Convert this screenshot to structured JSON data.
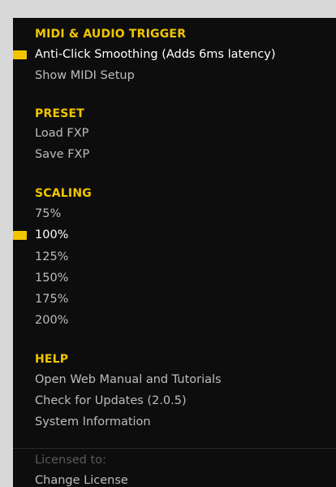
{
  "sections": {
    "midi_audio": {
      "title": "MIDI & AUDIO TRIGGER",
      "items": [
        {
          "label": "Anti-Click Smoothing (Adds 6ms latency)",
          "checked": true
        },
        {
          "label": "Show MIDI Setup",
          "checked": false
        }
      ]
    },
    "preset": {
      "title": "PRESET",
      "items": [
        {
          "label": "Load FXP",
          "checked": false
        },
        {
          "label": "Save FXP",
          "checked": false
        }
      ]
    },
    "scaling": {
      "title": "SCALING",
      "items": [
        {
          "label": "75%",
          "checked": false
        },
        {
          "label": "100%",
          "checked": true
        },
        {
          "label": "125%",
          "checked": false
        },
        {
          "label": "150%",
          "checked": false
        },
        {
          "label": "175%",
          "checked": false
        },
        {
          "label": "200%",
          "checked": false
        }
      ]
    },
    "help": {
      "title": "HELP",
      "items": [
        {
          "label": "Open Web Manual and Tutorials",
          "checked": false
        },
        {
          "label": "Check for Updates (2.0.5)",
          "checked": false
        },
        {
          "label": "System Information",
          "checked": false
        }
      ]
    }
  },
  "license": {
    "licensed_to_label": "Licensed to:",
    "change_license_label": "Change License"
  },
  "colors": {
    "accent": "#f2c500",
    "menu_bg": "#0d0d0d",
    "page_bg": "#d8d8d8",
    "item_text": "#bdbdbd",
    "active_text": "#ffffff",
    "disabled_text": "#5a5a5a"
  }
}
